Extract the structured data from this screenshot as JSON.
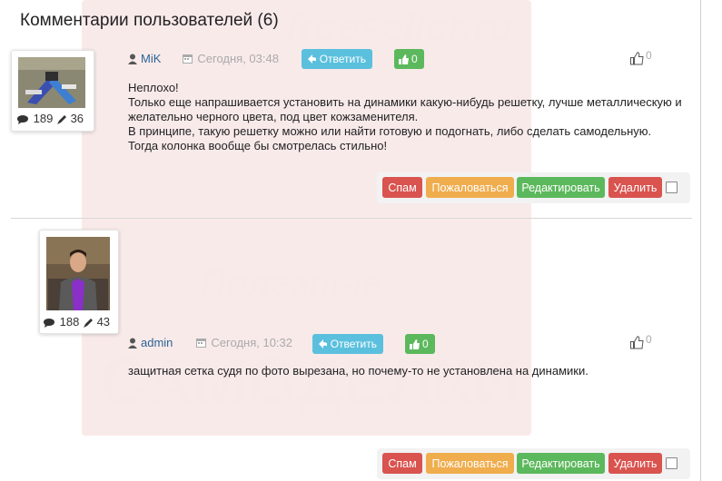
{
  "header": {
    "title": "Комментарии пользователей (6)"
  },
  "watermark": {
    "site": "freeseller.ru",
    "line1": "Полезные",
    "line2": "САМОДЕЛКИ"
  },
  "comments": [
    {
      "author": "MiK",
      "date": "Сегодня, 03:48",
      "reply_label": "Ответить",
      "likes": "0",
      "rating": "0",
      "stats": {
        "comments": "189",
        "posts": "36"
      },
      "text": [
        "Неплохо!",
        "Только еще напрашивается установить на динамики какую-нибудь решетку, лучше металлическую и",
        "желательно черного цвета, под цвет кожзаменителя.",
        "В принципе, такую решетку можно или найти готовую и подогнать, либо сделать самодельную.",
        "Тогда колонка вообще бы смотрелась стильно!"
      ],
      "actions": {
        "spam": "Спам",
        "report": "Пожаловаться",
        "edit": "Редактировать",
        "delete": "Удалить"
      }
    },
    {
      "author": "admin",
      "date": "Сегодня, 10:32",
      "reply_label": "Ответить",
      "likes": "0",
      "rating": "0",
      "stats": {
        "comments": "188",
        "posts": "43"
      },
      "text": [
        "защитная сетка судя по фото вырезана, но почему-то не установлена на динамики."
      ],
      "actions": {
        "spam": "Спам",
        "report": "Пожаловаться",
        "edit": "Редактировать",
        "delete": "Удалить"
      }
    }
  ],
  "colors": {
    "link": "#2a6496",
    "reply": "#5bc0de",
    "like": "#5cb85c",
    "spam": "#d9534f",
    "report": "#f0ad4e"
  }
}
